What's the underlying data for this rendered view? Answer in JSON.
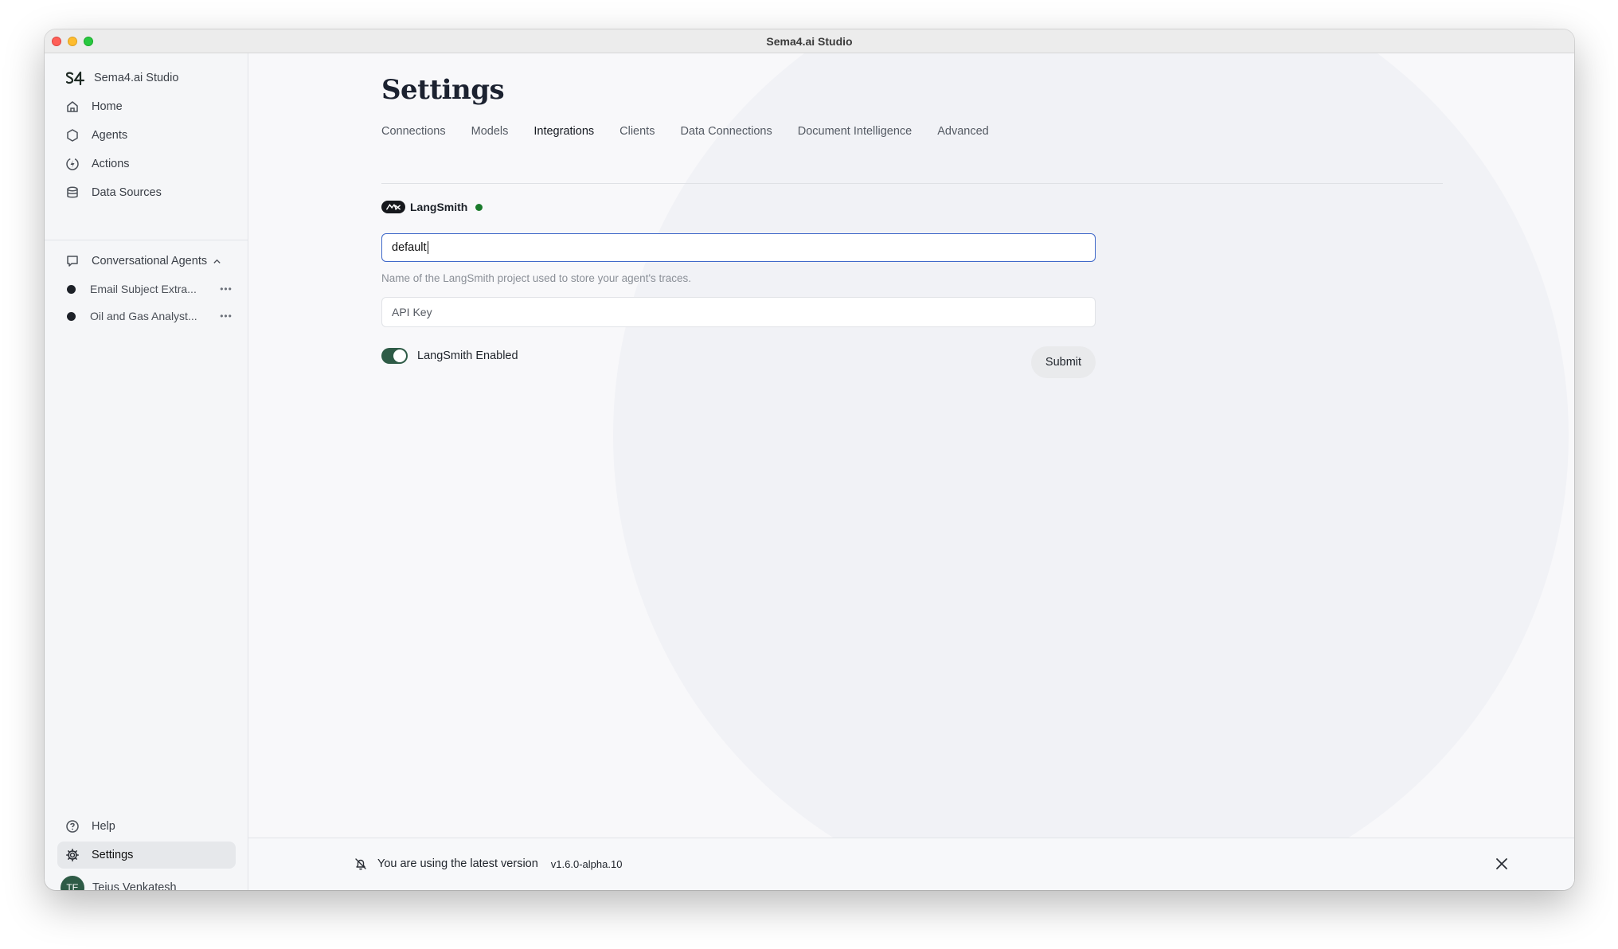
{
  "window": {
    "title": "Sema4.ai Studio"
  },
  "sidebar": {
    "brand": "Sema4.ai Studio",
    "items": [
      {
        "label": "Home",
        "icon": "home-icon"
      },
      {
        "label": "Agents",
        "icon": "hexagon-icon"
      },
      {
        "label": "Actions",
        "icon": "bolt-icon"
      },
      {
        "label": "Data Sources",
        "icon": "database-icon"
      }
    ],
    "conversational": {
      "label": "Conversational Agents",
      "agents": [
        {
          "name": "Email Subject Extra..."
        },
        {
          "name": "Oil and Gas Analyst..."
        }
      ]
    },
    "help": "Help",
    "settings": "Settings",
    "user": {
      "initials": "TE",
      "name": "Tejus Venkatesh"
    }
  },
  "main": {
    "title": "Settings",
    "tabs": [
      {
        "label": "Connections"
      },
      {
        "label": "Models"
      },
      {
        "label": "Integrations",
        "active": true
      },
      {
        "label": "Clients"
      },
      {
        "label": "Data Connections"
      },
      {
        "label": "Document Intelligence"
      },
      {
        "label": "Advanced"
      }
    ],
    "integration": {
      "name": "LangSmith",
      "status_color": "#1a7a2b",
      "project_value": "default",
      "project_helper": "Name of the LangSmith project used to store your agent's traces.",
      "api_key_placeholder": "API Key",
      "toggle_label": "LangSmith Enabled",
      "toggle_on": true,
      "submit_label": "Submit"
    }
  },
  "footer": {
    "message": "You are using the latest version",
    "version": "v1.6.0-alpha.10"
  },
  "colors": {
    "accent": "#2e5b46",
    "focus_border": "#3f68c9"
  }
}
